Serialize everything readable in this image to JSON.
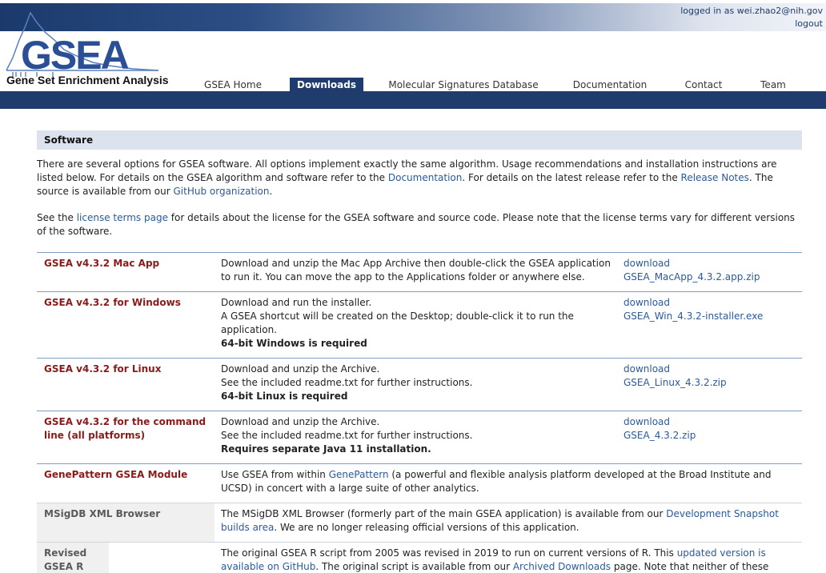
{
  "header": {
    "user": "logged in as wei.zhao2@nih.gov",
    "logout": "logout",
    "logo_text": "GSEA",
    "logo_subtitle": "Gene Set Enrichment Analysis",
    "logo_color": "#2a4f97",
    "nav_color": "#1f3c6c",
    "nav": [
      {
        "label": "GSEA Home",
        "active": false
      },
      {
        "label": "Downloads",
        "active": true
      },
      {
        "label": "Molecular Signatures Database",
        "active": false
      },
      {
        "label": "Documentation",
        "active": false
      },
      {
        "label": "Contact",
        "active": false
      },
      {
        "label": "Team",
        "active": false
      }
    ]
  },
  "section": {
    "title": "Software",
    "intro": {
      "p1_a": "There are several options for GSEA software. All options implement exactly the same algorithm. Usage recommendations and installation instructions are listed below. For details on the GSEA algorithm and software refer to the ",
      "p1_link1": "Documentation",
      "p1_b": ". For details on the latest release refer to the ",
      "p1_link2": "Release Notes",
      "p1_c": ". The source is available from our ",
      "p1_link3": "GitHub organization",
      "p1_d": ".",
      "p2_a": "See the ",
      "p2_link": "license terms page",
      "p2_b": " for details about the license for the GSEA software and source code. Please note that the license terms vary for different versions of the software."
    }
  },
  "downloads": [
    {
      "name": "GSEA v4.3.2 Mac App",
      "desc": [
        "Download and unzip the Mac App Archive then double-click the GSEA application to run it. You can move the app to the Applications folder or anywhere else."
      ],
      "note": "",
      "link_label": "download",
      "file": "GSEA_MacApp_4.3.2.app.zip"
    },
    {
      "name": "GSEA v4.3.2 for Windows",
      "desc": [
        "Download and run the installer.",
        "A GSEA shortcut will be created on the Desktop; double-click it to run the application."
      ],
      "note": "64-bit Windows is required",
      "link_label": "download",
      "file": "GSEA_Win_4.3.2-installer.exe"
    },
    {
      "name": "GSEA v4.3.2 for Linux",
      "desc": [
        "Download and unzip the Archive.",
        "See the included readme.txt for further instructions."
      ],
      "note": "64-bit Linux is required",
      "link_label": "download",
      "file": "GSEA_Linux_4.3.2.zip"
    },
    {
      "name": "GSEA v4.3.2 for the command line (all platforms)",
      "desc": [
        "Download and unzip the Archive.",
        "See the included readme.txt for further instructions."
      ],
      "note": "Requires separate Java 11 installation.",
      "link_label": "download",
      "file": "GSEA_4.3.2.zip"
    }
  ],
  "genepattern": {
    "name": "GenePattern GSEA Module",
    "a": "Use GSEA from within ",
    "link": "GenePattern",
    "b": " (a powerful and flexible analysis platform developed at the Broad Institute and UCSD) in concert with a large suite of other analytics."
  },
  "msigdb_browser": {
    "name": "MSigDB XML Browser",
    "a": "The MSigDB XML Browser (formerly part of the main GSEA application) is available from our ",
    "link": "Development Snapshot builds area",
    "b": ". We are no longer releasing official versions of this application."
  },
  "revised_r": {
    "name": "Revised GSEA R script",
    "a": "The original GSEA R script from 2005 was revised in 2019 to run on current versions of R. This ",
    "link1": "updated version is available on GitHub",
    "b": ". The original script is available from our ",
    "link2": "Archived Downloads",
    "c": " page. Note that neither of these GSEA R"
  }
}
